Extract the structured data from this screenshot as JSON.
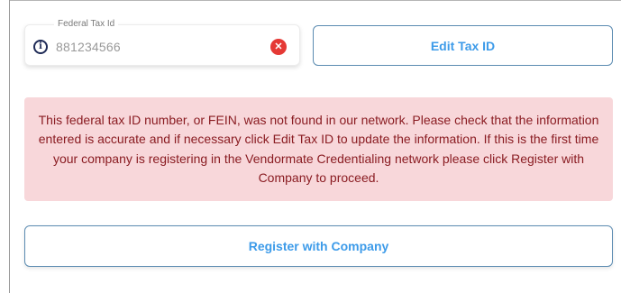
{
  "tax_field": {
    "label": "Federal Tax Id",
    "value": "881234566",
    "info_icon": "i",
    "clear_icon": "✕"
  },
  "buttons": {
    "edit_tax_id": "Edit Tax ID",
    "register_with_company": "Register with Company"
  },
  "alert": {
    "message": "This federal tax ID number, or FEIN, was not found in our network. Please check that the information entered is accurate and if necessary click Edit Tax ID to update the information. If this is the first time your company is registering in the Vendormate Credentialing network please click Register with Company to proceed."
  },
  "colors": {
    "accent": "#3d9be9",
    "button_border": "#5b8bb1",
    "alert_background": "#f8d7da",
    "alert_text": "#8a1c22",
    "clear_icon": "#e53935",
    "info_icon": "#1f2b57"
  },
  "icons": [
    "info-icon",
    "clear-icon"
  ]
}
